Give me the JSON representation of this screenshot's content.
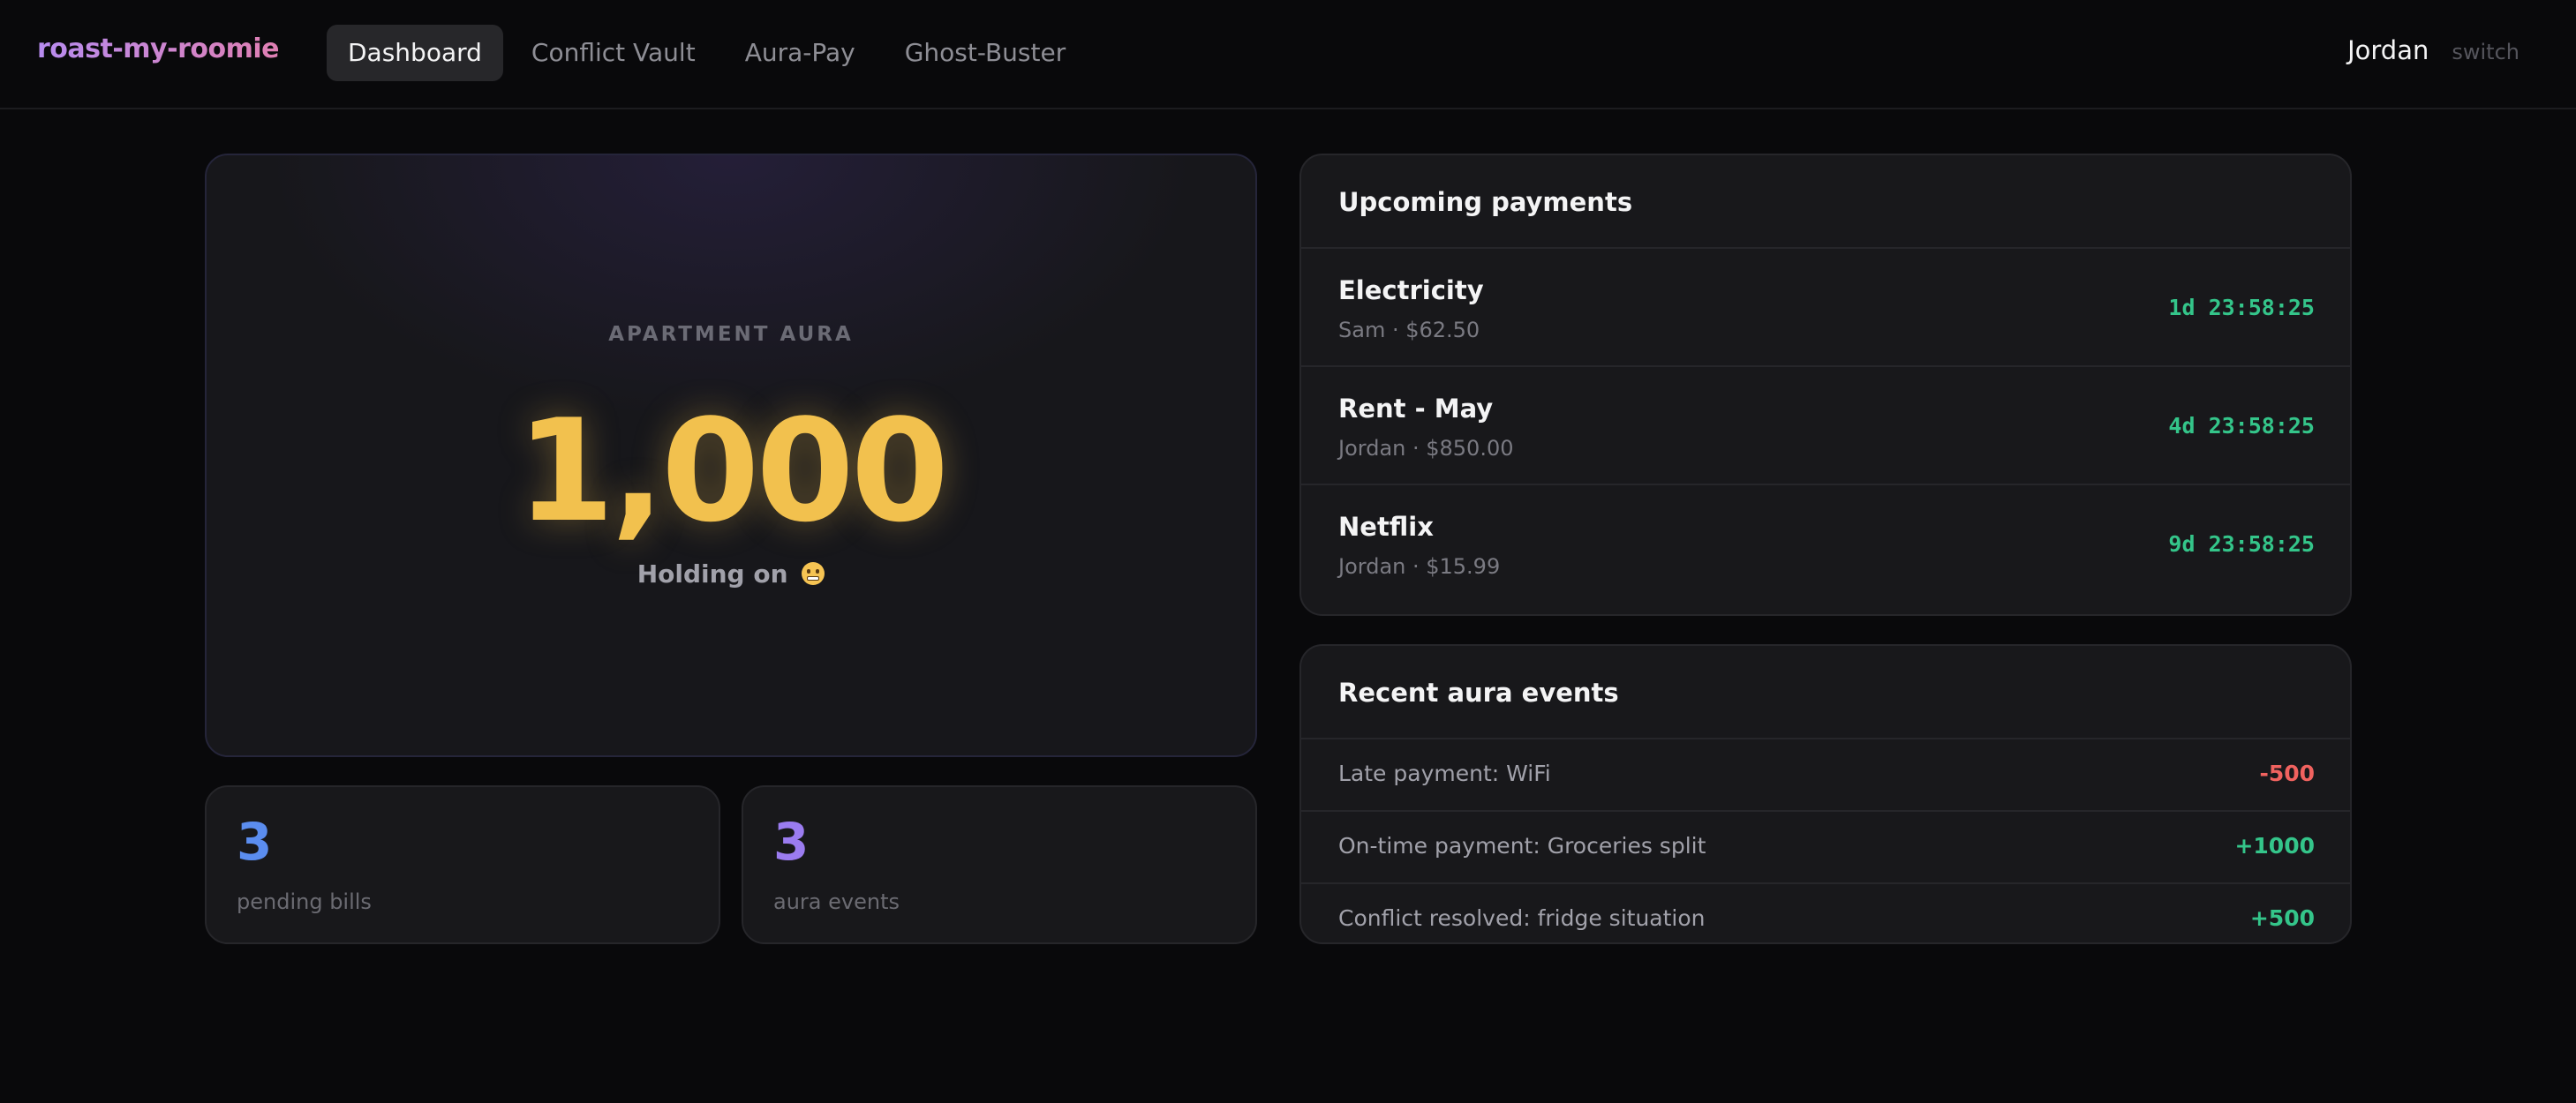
{
  "app": {
    "name": "roast-my-roomie"
  },
  "nav": {
    "items": [
      {
        "label": "Dashboard",
        "active": true
      },
      {
        "label": "Conflict Vault",
        "active": false
      },
      {
        "label": "Aura-Pay",
        "active": false
      },
      {
        "label": "Ghost-Buster",
        "active": false
      }
    ]
  },
  "user": {
    "name": "Jordan",
    "switch_label": "switch"
  },
  "aura": {
    "label": "APARTMENT AURA",
    "value": "1,000",
    "status": "Holding on",
    "status_icon": "grimacing-face-emoji",
    "color": "#f2c14e"
  },
  "stats": [
    {
      "value": "3",
      "label": "pending bills",
      "color": "#5b8def"
    },
    {
      "value": "3",
      "label": "aura events",
      "color": "#9b7cf0"
    }
  ],
  "payments": {
    "title": "Upcoming payments",
    "rows": [
      {
        "name": "Electricity",
        "meta": "Sam · $62.50",
        "countdown": "1d 23:58:25"
      },
      {
        "name": "Rent - May",
        "meta": "Jordan · $850.00",
        "countdown": "4d 23:58:25"
      },
      {
        "name": "Netflix",
        "meta": "Jordan · $15.99",
        "countdown": "9d 23:58:25"
      }
    ]
  },
  "events": {
    "title": "Recent aura events",
    "rows": [
      {
        "text": "Late payment: WiFi",
        "delta": "-500",
        "color": "#f0625f"
      },
      {
        "text": "On-time payment: Groceries split",
        "delta": "+1000",
        "color": "#34c58a"
      },
      {
        "text": "Conflict resolved: fridge situation",
        "delta": "+500",
        "color": "#34c58a"
      }
    ]
  }
}
